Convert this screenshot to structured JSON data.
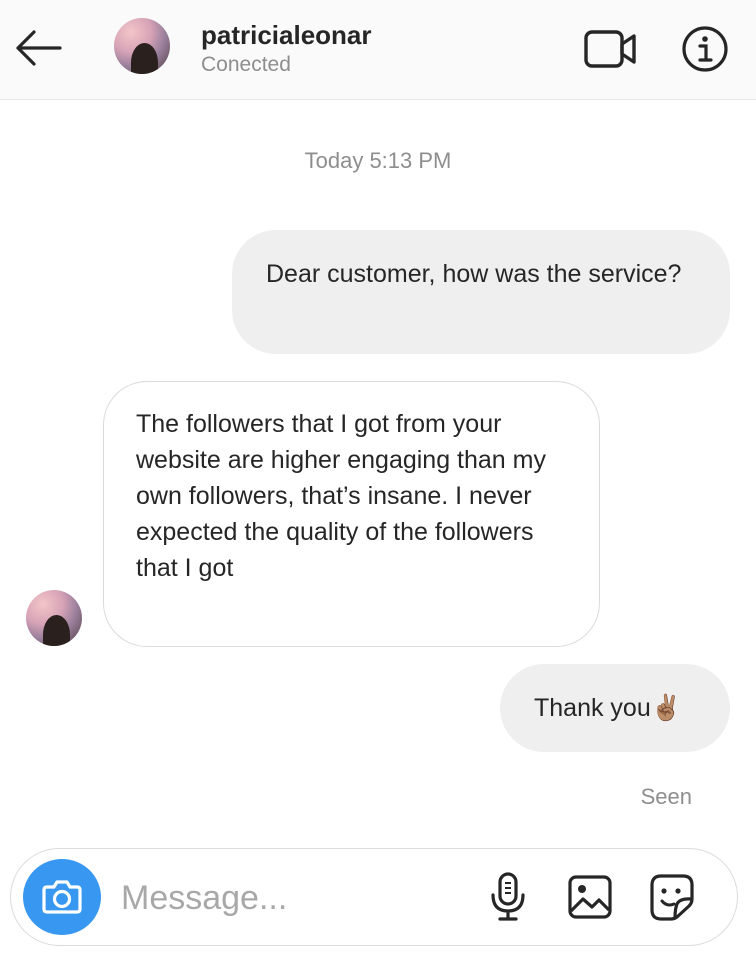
{
  "header": {
    "username": "patricialeonar",
    "status": "Conected",
    "icons": {
      "back": "arrow-left-icon",
      "video": "video-camera-icon",
      "info": "info-icon"
    }
  },
  "chat": {
    "timestamp": "Today 5:13 PM",
    "messages": [
      {
        "direction": "outgoing",
        "text": "Dear customer, how was the service?"
      },
      {
        "direction": "incoming",
        "text": "The followers that I got from your website are higher engaging than my own followers, that’s insane. I never expected the quality of the followers that I got"
      },
      {
        "direction": "outgoing",
        "text": "Thank you✌🏽"
      }
    ],
    "seen_label": "Seen"
  },
  "composer": {
    "placeholder": "Message...",
    "icons": {
      "camera": "camera-icon",
      "mic": "microphone-icon",
      "gallery": "image-gallery-icon",
      "sticker": "sticker-icon"
    }
  },
  "colors": {
    "accent": "#3897f0",
    "outgoing_bubble": "#efefef",
    "muted_text": "#8e8e8e"
  }
}
